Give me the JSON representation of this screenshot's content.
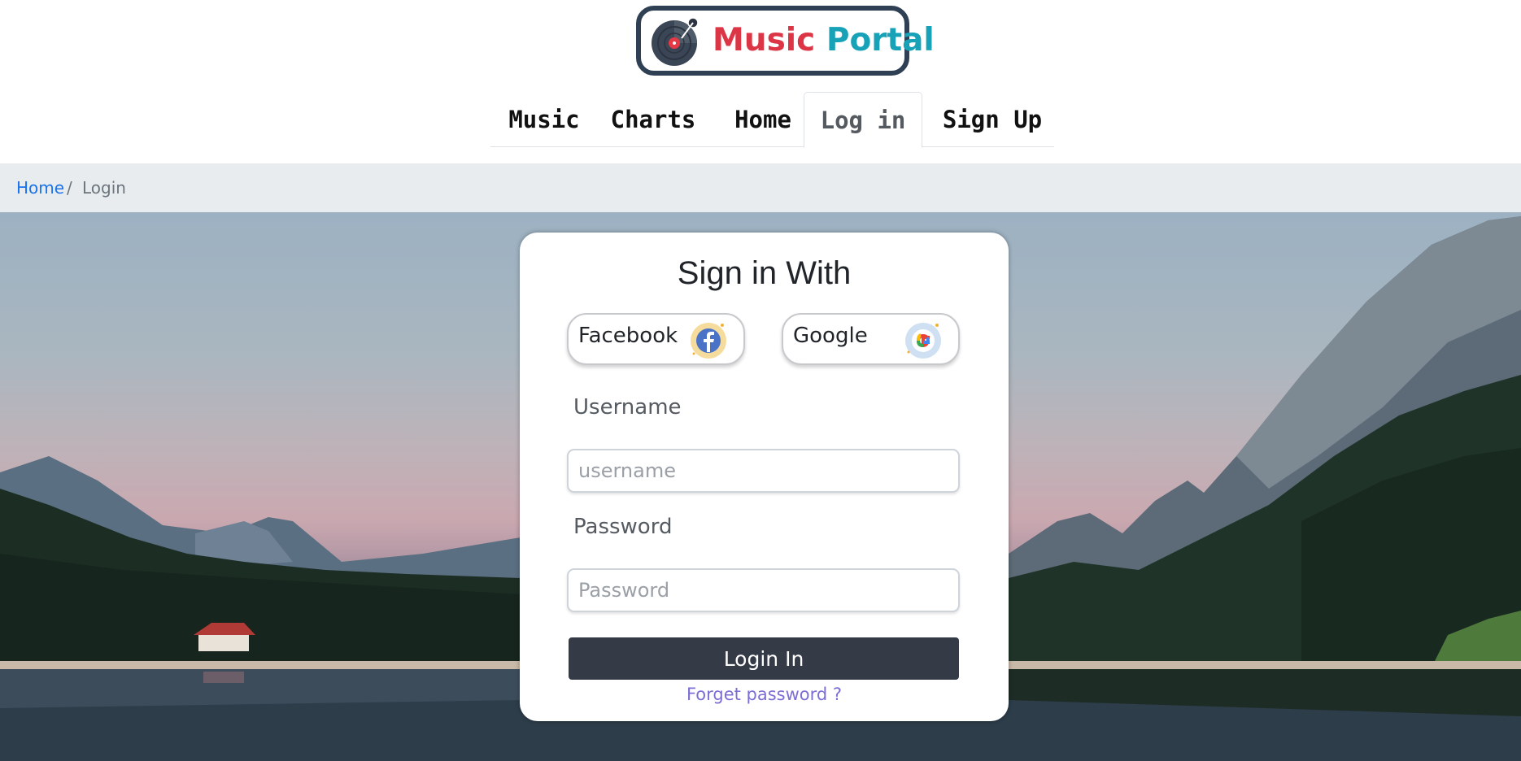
{
  "brand": {
    "word1": "Music",
    "word2": "Portal",
    "colors": {
      "word1": "#dc3545",
      "word2": "#17a2b8",
      "frame": "#2f3f54"
    },
    "icon": "vinyl-record-icon"
  },
  "nav": {
    "items": [
      {
        "label": "Music",
        "active": false
      },
      {
        "label": "Charts",
        "active": false
      },
      {
        "label": "Home",
        "active": false
      },
      {
        "label": "Log in",
        "active": true
      },
      {
        "label": "Sign Up",
        "active": false
      }
    ]
  },
  "breadcrumb": {
    "home": "Home",
    "separator": "/",
    "current": "Login"
  },
  "login": {
    "title": "Sign in With",
    "social": {
      "facebook_label": "Facebook",
      "facebook_icon": "facebook-icon",
      "google_label": "Google",
      "google_icon": "google-icon"
    },
    "username_label": "Username",
    "username_placeholder": "username",
    "username_value": "",
    "password_label": "Password",
    "password_placeholder": "Password",
    "password_value": "",
    "submit_label": "Login In",
    "forgot_label": "Forget password ?",
    "colors": {
      "button": "#343a46",
      "link": "#7b6fd6"
    }
  }
}
